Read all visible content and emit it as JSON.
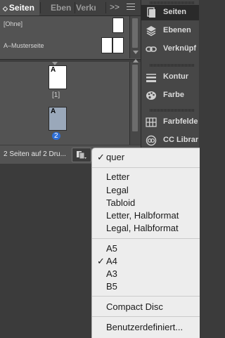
{
  "tabs": {
    "seiten": "Seiten",
    "ebenen": "Eben",
    "verk": "Verkn",
    "more": ">>"
  },
  "masters": {
    "none_label": "[Ohne]",
    "a_label": "A–Musterseite"
  },
  "pages": [
    {
      "prefix": "A",
      "number": "[1]",
      "selected": false
    },
    {
      "prefix": "A",
      "number": "2",
      "selected": true
    }
  ],
  "status_text": "2 Seiten auf 2 Dru...",
  "dock": {
    "items": [
      {
        "label": "Seiten",
        "icon": "pages-icon",
        "active": true
      },
      {
        "label": "Ebenen",
        "icon": "layers-icon",
        "active": false
      },
      {
        "label": "Verknüpf",
        "icon": "links-icon",
        "active": false
      },
      {
        "label": "Kontur",
        "icon": "stroke-icon",
        "active": false
      },
      {
        "label": "Farbe",
        "icon": "color-palette-icon",
        "active": false
      },
      {
        "label": "Farbfelde",
        "icon": "swatches-icon",
        "active": false
      },
      {
        "label": "CC Librar",
        "icon": "cc-libraries-icon",
        "active": false
      }
    ]
  },
  "menu": {
    "orientation": {
      "label": "quer",
      "checked": true
    },
    "paper": [
      "Letter",
      "Legal",
      "Tabloid",
      "Letter, Halbformat",
      "Legal, Halbformat"
    ],
    "iso": [
      {
        "label": "A5",
        "checked": false
      },
      {
        "label": "A4",
        "checked": true
      },
      {
        "label": "A3",
        "checked": false
      },
      {
        "label": "B5",
        "checked": false
      }
    ],
    "compact_disc": "Compact Disc",
    "custom": "Benutzerdefiniert..."
  }
}
